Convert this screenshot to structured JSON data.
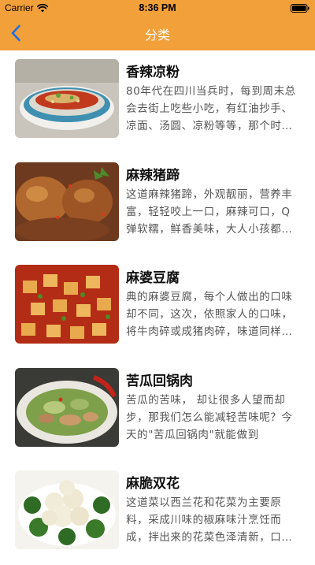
{
  "status_bar": {
    "carrier": "Carrier",
    "time": "8:36 PM",
    "wifi_icon": "wifi-icon",
    "battery_icon": "battery-full-icon"
  },
  "nav": {
    "title": "分类",
    "back_icon": "chevron-left-icon",
    "background_color": "#f2a03a",
    "title_color": "#ffffff"
  },
  "recipes": [
    {
      "title": "香辣凉粉",
      "description": "80年代在四川当兵时，每到周末总会去街上吃些小吃，有红油抄手、凉面、汤圆、凉粉等等，那个时候的凉粉最让人难忘"
    },
    {
      "title": "麻辣猪蹄",
      "description": "这道麻辣猪蹄，外观靓丽，营养丰富，轻轻咬上一口，麻辣可口，Q弹软糯，鲜香美味，大人小孩都喜欢"
    },
    {
      "title": "麻婆豆腐",
      "description": "典的麻婆豆腐，每个人做出的口味却不同，这次，依照家人的口味，将牛肉碎或成猪肉碎，味道同样鲜美"
    },
    {
      "title": "苦瓜回锅肉",
      "description": "苦瓜的苦味， 却让很多人望而却步，那我们怎么能减轻苦味呢？今天的\"苦瓜回锅肉\"就能做到"
    },
    {
      "title": "麻脆双花",
      "description": "这道菜以西兰花和花菜为主要原料，采成川味的椒麻味汁烹饪而成，拌出来的花菜色泽清新，口感脆嫩"
    }
  ]
}
